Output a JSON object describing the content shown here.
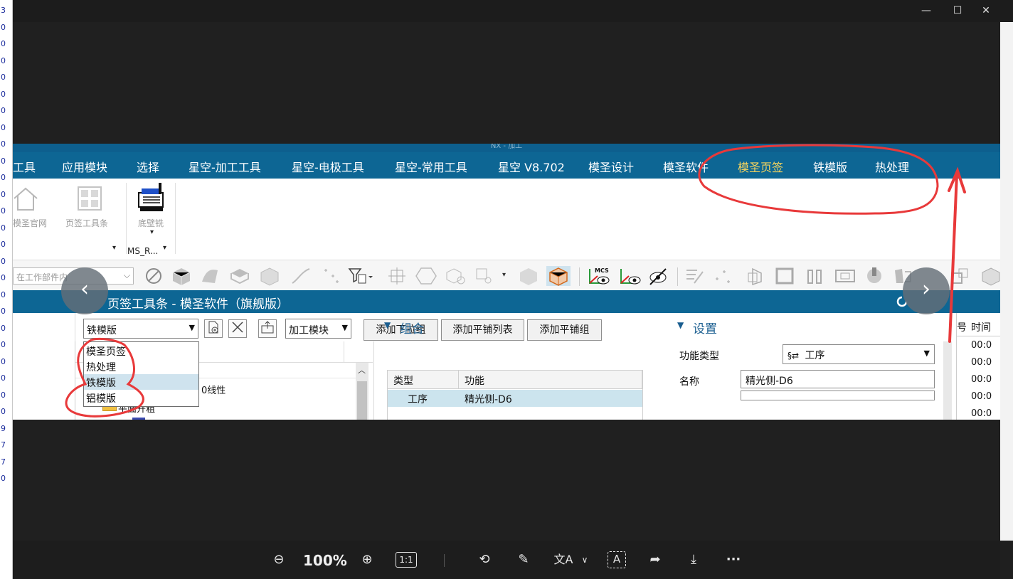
{
  "left_strip": {
    "chars": [
      "3",
      "0",
      "0",
      "0",
      "0",
      "0",
      "0",
      "0",
      "0",
      "0",
      "0",
      "0",
      "0",
      "0",
      "0",
      "0",
      "0",
      "0",
      "0",
      "0",
      "0",
      "0",
      "0",
      "0",
      "0",
      "9",
      "7",
      "7",
      "0"
    ]
  },
  "window": {
    "minimize_label": "—",
    "maximize_label": "☐",
    "close_label": "✕"
  },
  "screenshot": {
    "nx_title": "NX - 加工",
    "menu": {
      "items": [
        "工具",
        "应用模块",
        "选择",
        "星空-加工工具",
        "星空-电极工具",
        "星空-常用工具",
        "星空 V8.702",
        "模圣设计",
        "模圣软件",
        "模圣页签",
        "铁模版",
        "热处理"
      ],
      "active": "模圣页签"
    },
    "ribbon": {
      "home_label": "模圣官网",
      "toolbar_label": "页签工具条",
      "cmd_label": "底壁铣",
      "group_label": "MS_R...",
      "dropdown_arrow": "▾"
    },
    "toolbar": {
      "scope_placeholder": "在工作部件内",
      "mcs_label": "MCS"
    },
    "dialog": {
      "title": "页签工具条 - 模圣软件（旗舰版）",
      "tab_select_value": "铁模版",
      "module_select_value": "加工模块",
      "buttons": [
        "添加下拉组",
        "添加平铺列表",
        "添加平铺组"
      ],
      "tab_options": [
        "模圣页签",
        "热处理",
        "铁模版",
        "铝模版"
      ],
      "selected_tab_option": "铁模版",
      "tree_items": [
        "0线性",
        "平面开粗"
      ],
      "group_section": "组合",
      "settings_section": "设置",
      "grid": {
        "headers": [
          "类型",
          "功能"
        ],
        "rows": [
          {
            "type": "工序",
            "func": "精光侧-D6"
          }
        ]
      },
      "settings": {
        "func_type_label": "功能类型",
        "func_type_value": "工序",
        "name_label": "名称",
        "name_value": "精光侧-D6"
      },
      "right_table": {
        "col_number": "号",
        "col_time": "时间",
        "time_values": [
          "00:0",
          "00:0",
          "00:0",
          "00:0",
          "00:0"
        ]
      }
    }
  },
  "nav": {
    "prev_label": "‹",
    "next_label": "›"
  },
  "bottom": {
    "zoom_level": "100%",
    "zoom_out_label": "⊖",
    "zoom_in_label": "⊕",
    "actual_size_label": "1:1",
    "rotate_label": "⟲",
    "edit_label": "✎",
    "translate_label": "文A",
    "translate_dropdown": "∨",
    "ocr_label": "A",
    "share_label": "➦",
    "download_label": "⤓",
    "more_label": "···"
  },
  "colors": {
    "annotation_red": "#e8393a",
    "nx_blue": "#0d6694",
    "active_menu": "#f4d35e"
  }
}
